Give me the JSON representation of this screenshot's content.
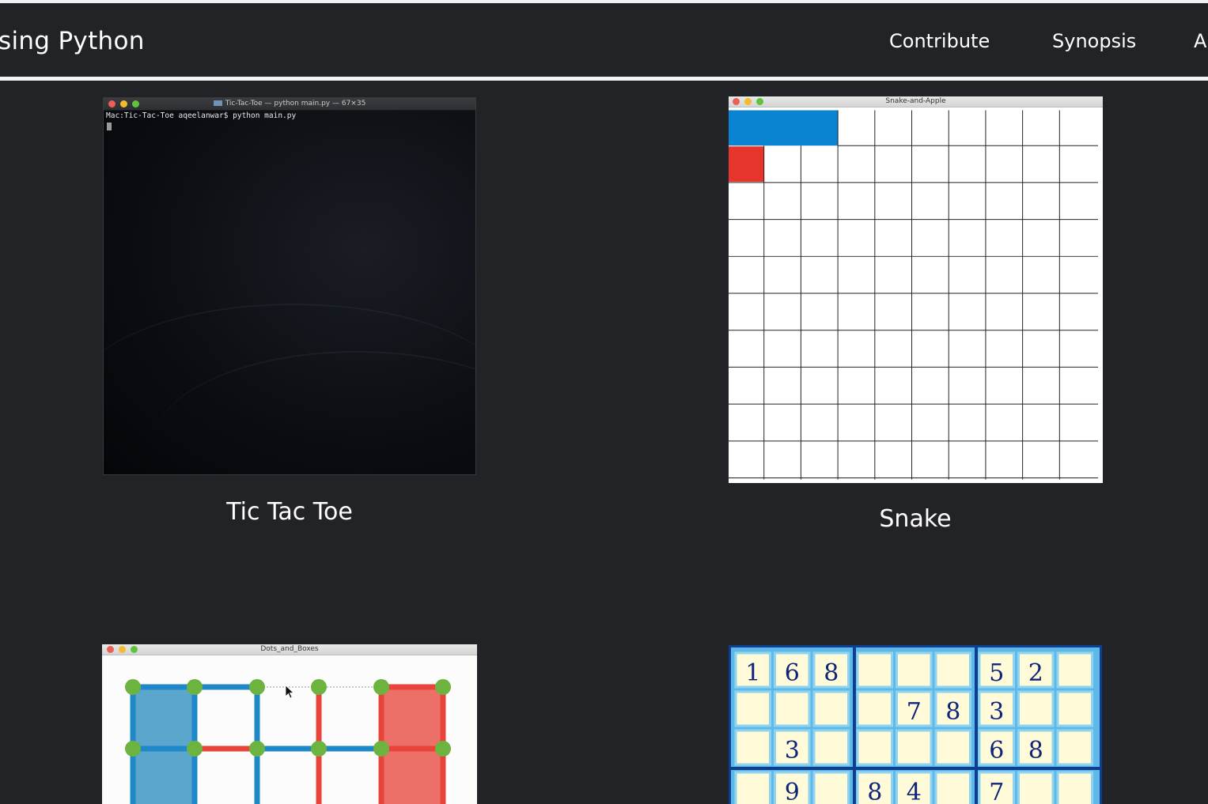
{
  "navbar": {
    "brand": "sing Python",
    "links": [
      {
        "label": "Contribute"
      },
      {
        "label": "Synopsis"
      },
      {
        "label": "A"
      }
    ]
  },
  "cards": [
    {
      "caption": "Tic Tac Toe",
      "window": {
        "title": "Tic-Tac-Toe — python main.py — 67×35",
        "prompt_line": "Mac:Tic-Tac-Toe aqeelanwar$ python main.py"
      }
    },
    {
      "caption": "Snake",
      "window": {
        "title": "Snake-and-Apple",
        "snake_color": "#0a84d0",
        "apple_color": "#e8352b"
      }
    },
    {
      "caption": "",
      "window": {
        "title": "Dots_and_Boxes",
        "player1_color": "#1f88c9",
        "player2_color": "#e8443a",
        "dot_color": "#6cb33f"
      }
    },
    {
      "caption": "",
      "window": {
        "rows": [
          [
            "1",
            "6",
            "8",
            "",
            "",
            "",
            "5",
            "2",
            ""
          ],
          [
            "",
            "",
            "",
            "",
            "7",
            "8",
            "3",
            "",
            ""
          ],
          [
            "",
            "3",
            "",
            "",
            "",
            "",
            "6",
            "8",
            ""
          ],
          [
            "",
            "9",
            "",
            "8",
            "4",
            "",
            "7",
            "",
            ""
          ]
        ]
      }
    }
  ],
  "colors": {
    "background": "#222327",
    "text": "#ffffff",
    "sudoku_cell": "#fffbd8",
    "sudoku_border": "#1d5fc1"
  }
}
